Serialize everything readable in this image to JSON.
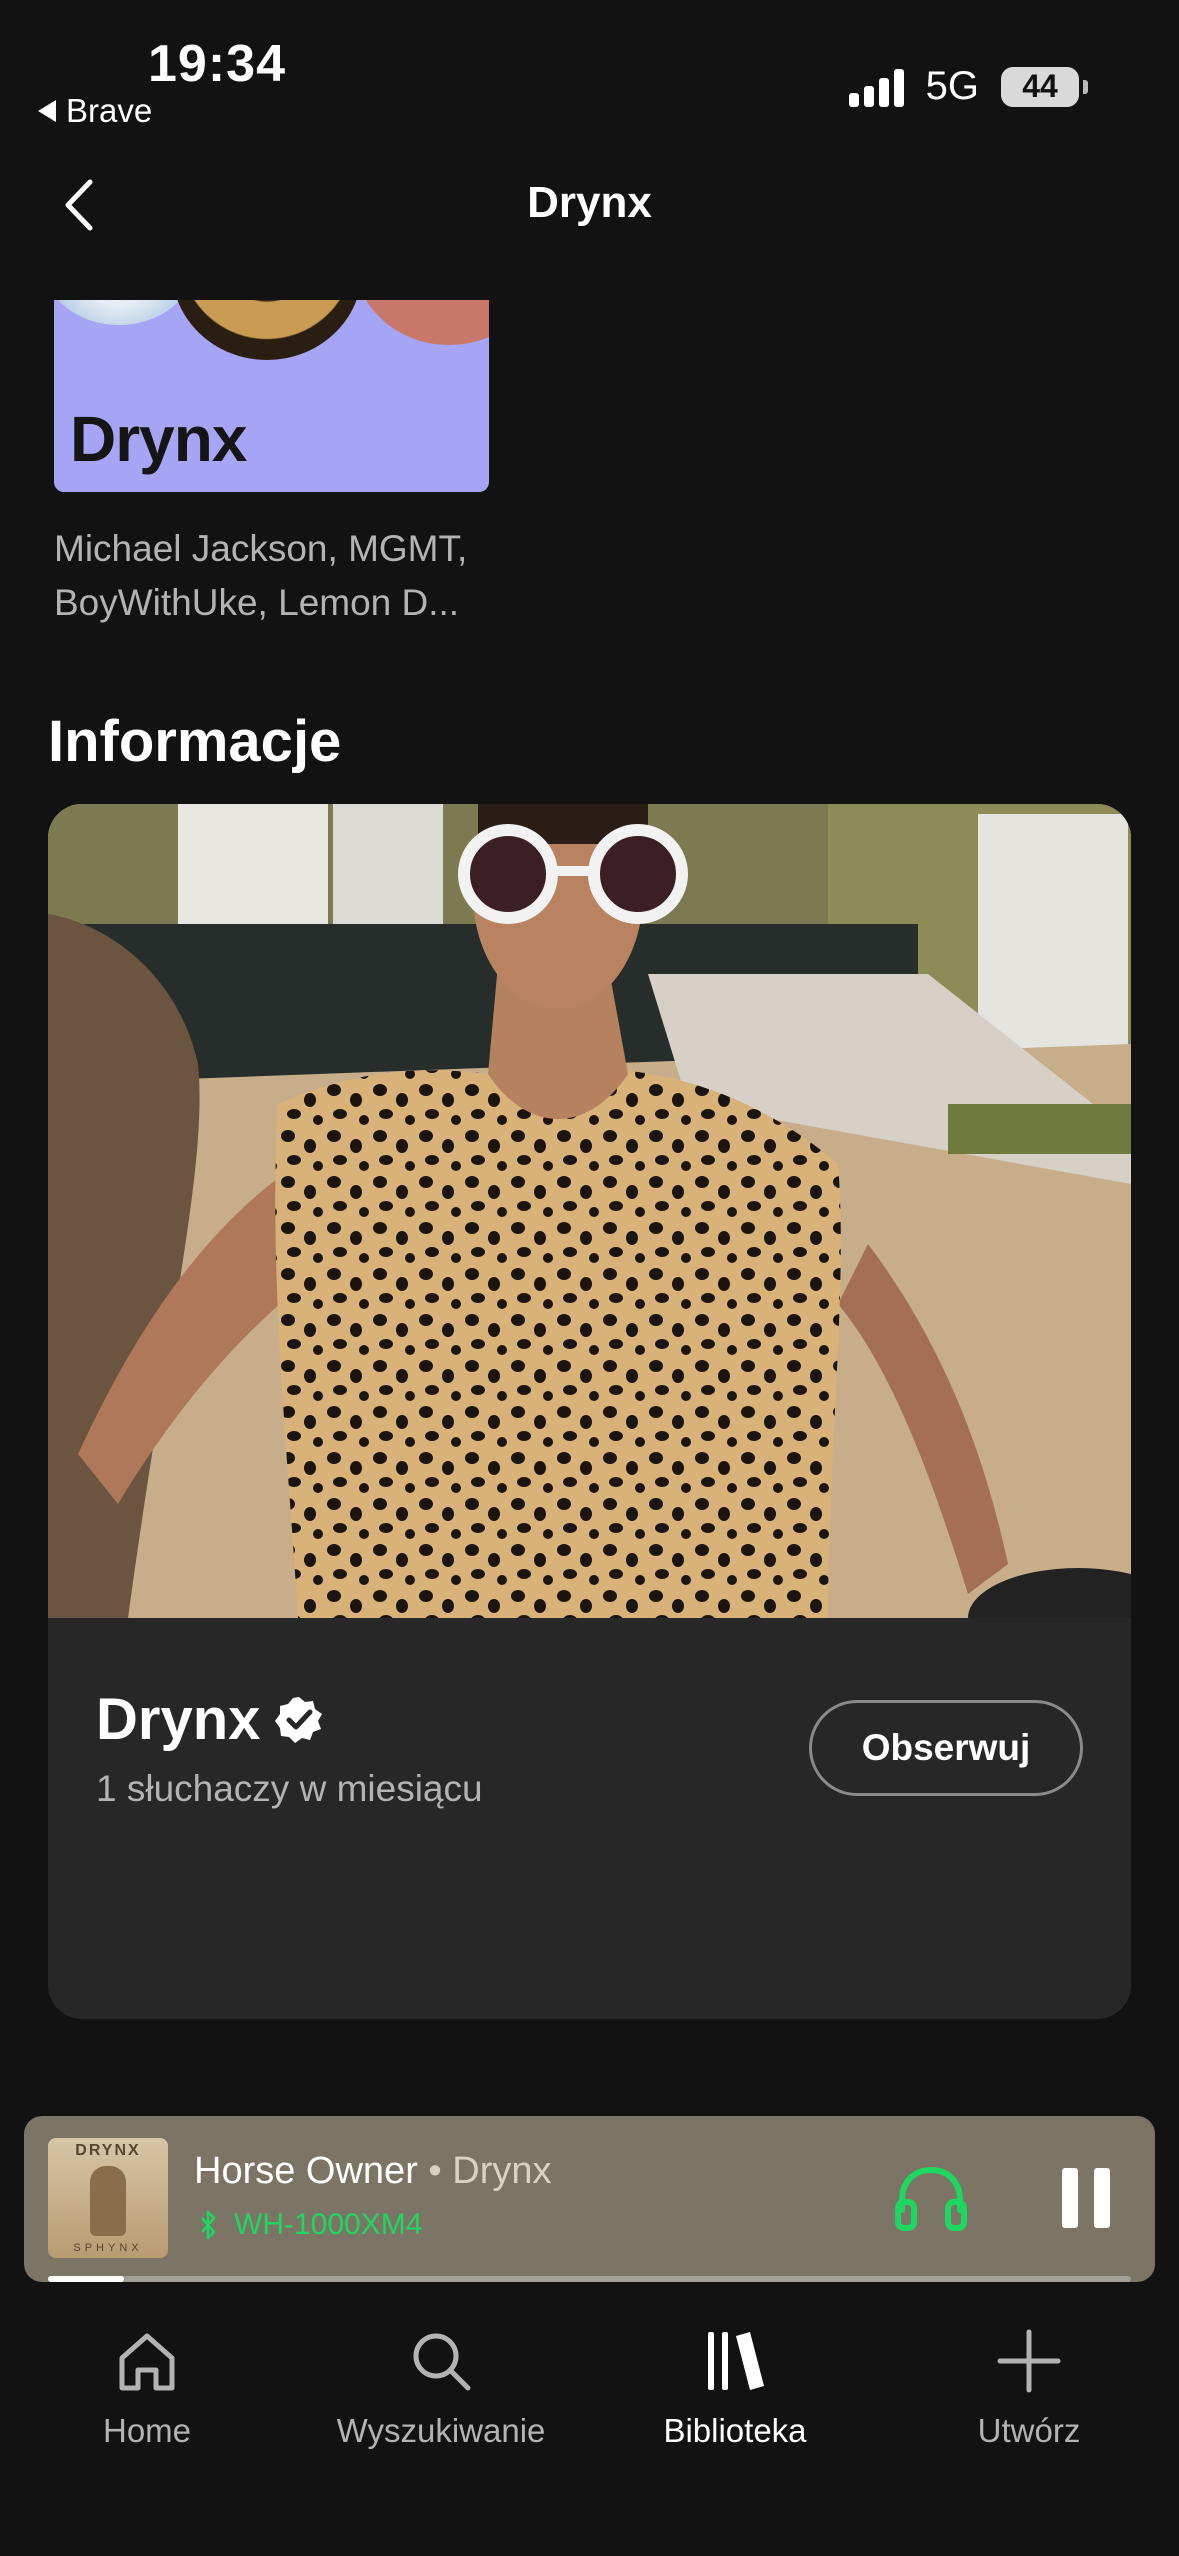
{
  "status_bar": {
    "time": "19:34",
    "back_app": "Brave",
    "network": "5G",
    "battery": "44"
  },
  "nav": {
    "title": "Drynx"
  },
  "playlist": {
    "title": "Drynx",
    "description": "Michael Jackson, MGMT, BoyWithUke, Lemon D..."
  },
  "section": {
    "title": "Informacje"
  },
  "about": {
    "artist_name": "Drynx",
    "monthly_listeners": "1 słuchaczy w miesiącu",
    "follow_label": "Obserwuj"
  },
  "mini_player": {
    "track": "Horse Owner",
    "separator": " • ",
    "artist": "Drynx",
    "device": "WH-1000XM4",
    "art_label": "DRYNX",
    "art_sub": "SPHYNX",
    "progress": 0.07,
    "accent_color": "#1ed760"
  },
  "tabs": [
    {
      "label": "Home",
      "icon": "home-icon",
      "active": false
    },
    {
      "label": "Wyszukiwanie",
      "icon": "search-icon",
      "active": false
    },
    {
      "label": "Biblioteka",
      "icon": "library-icon",
      "active": true
    },
    {
      "label": "Utwórz",
      "icon": "plus-icon",
      "active": false
    }
  ]
}
